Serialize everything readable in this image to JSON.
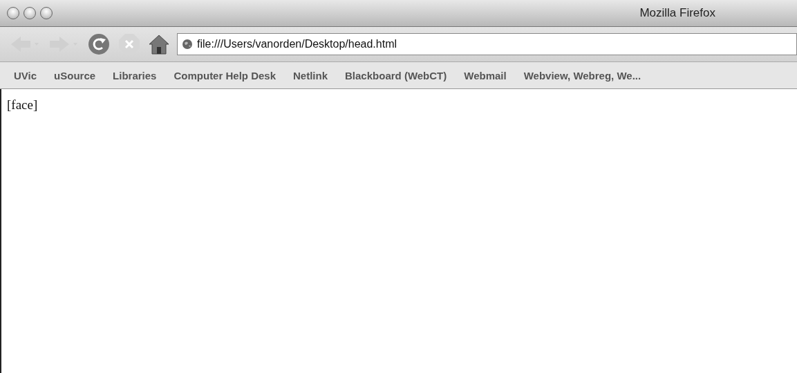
{
  "window": {
    "title": "Mozilla Firefox"
  },
  "toolbar": {
    "back": {
      "disabled": true
    },
    "forward": {
      "disabled": true
    },
    "reload": {
      "disabled": false
    },
    "stop": {
      "disabled": true
    }
  },
  "address_bar": {
    "value": "file:///Users/vanorden/Desktop/head.html"
  },
  "bookmarks": [
    "UVic",
    "uSource",
    "Libraries",
    "Computer Help Desk",
    "Netlink",
    "Blackboard (WebCT)",
    "Webmail",
    "Webview, Webreg, We..."
  ],
  "page": {
    "text": "[face]"
  }
}
